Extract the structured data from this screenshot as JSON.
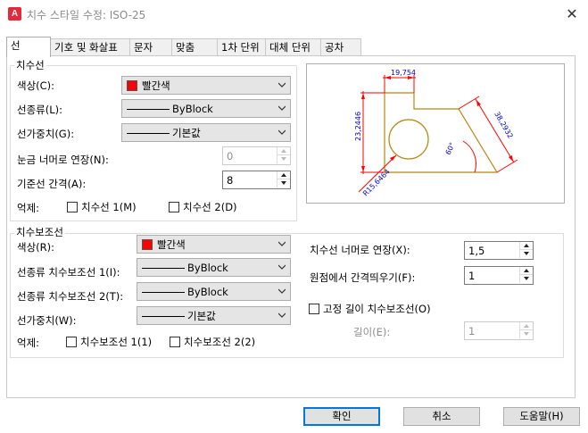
{
  "window": {
    "logo": "A",
    "title": "치수 스타일 수정: ISO-25",
    "close_glyph": "✕"
  },
  "tabs": [
    {
      "label": "선",
      "active": true
    },
    {
      "label": "기호 및 화살표"
    },
    {
      "label": "문자"
    },
    {
      "label": "맞춤"
    },
    {
      "label": "1차 단위"
    },
    {
      "label": "대체 단위"
    },
    {
      "label": "공차"
    }
  ],
  "dim_lines": {
    "group_label": "치수선",
    "color_label": "색상(C):",
    "color_value": "빨간색",
    "linetype_label": "선종류(L):",
    "linetype_value": "ByBlock",
    "lineweight_label": "선가중치(G):",
    "lineweight_value": "기본값",
    "extend_label": "눈금 너머로 연장(N):",
    "extend_value": "0",
    "baseline_label": "기준선 간격(A):",
    "baseline_value": "8",
    "suppress_label": "억제:",
    "suppress_1": "치수선 1(M)",
    "suppress_2": "치수선 2(D)"
  },
  "ext_lines": {
    "group_label": "치수보조선",
    "color_label": "색상(R):",
    "color_value": "빨간색",
    "linetype1_label": "선종류 치수보조선 1(I):",
    "linetype1_value": "ByBlock",
    "linetype2_label": "선종류 치수보조선 2(T):",
    "linetype2_value": "ByBlock",
    "lineweight_label": "선가중치(W):",
    "lineweight_value": "기본값",
    "suppress_label": "억제:",
    "suppress_1": "치수보조선 1(1)",
    "suppress_2": "치수보조선 2(2)",
    "extend_label": "치수선 너머로 연장(X):",
    "extend_value": "1,5",
    "offset_label": "원점에서 간격띄우기(F):",
    "offset_value": "1",
    "fixed_label": "고정 길이 치수보조선(O)",
    "length_label": "길이(E):",
    "length_value": "1"
  },
  "preview": {
    "dim_top": "19,754",
    "dim_left": "23,2446",
    "dim_right": "38,2932",
    "dim_angle": "60°",
    "dim_radius": "R15,6464",
    "colors": {
      "geometry": "#b8860b",
      "dimension": "#ff0000",
      "text": "#0000cc"
    }
  },
  "buttons": {
    "ok": "확인",
    "cancel": "취소",
    "help": "도움말(H)"
  },
  "colors": {
    "accent": "#0078d7",
    "swatch": "#ff0000"
  }
}
